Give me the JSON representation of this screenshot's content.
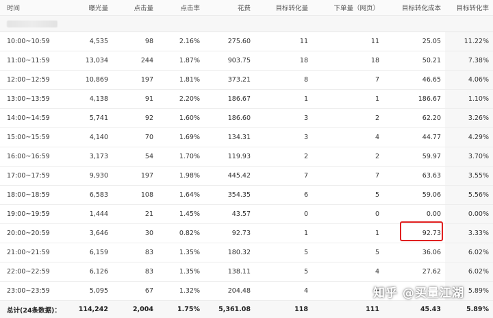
{
  "columns": [
    "时间",
    "曝光量",
    "点击量",
    "点击率",
    "花费",
    "目标转化量",
    "下单量（网页）",
    "目标转化成本",
    "目标转化率"
  ],
  "rows": [
    [
      "10:00~10:59",
      "4,535",
      "98",
      "2.16%",
      "275.60",
      "11",
      "11",
      "25.05",
      "11.22%"
    ],
    [
      "11:00~11:59",
      "13,034",
      "244",
      "1.87%",
      "903.75",
      "18",
      "18",
      "50.21",
      "7.38%"
    ],
    [
      "12:00~12:59",
      "10,869",
      "197",
      "1.81%",
      "373.21",
      "8",
      "7",
      "46.65",
      "4.06%"
    ],
    [
      "13:00~13:59",
      "4,138",
      "91",
      "2.20%",
      "186.67",
      "1",
      "1",
      "186.67",
      "1.10%"
    ],
    [
      "14:00~14:59",
      "5,741",
      "92",
      "1.60%",
      "186.60",
      "3",
      "2",
      "62.20",
      "3.26%"
    ],
    [
      "15:00~15:59",
      "4,140",
      "70",
      "1.69%",
      "134.31",
      "3",
      "4",
      "44.77",
      "4.29%"
    ],
    [
      "16:00~16:59",
      "3,173",
      "54",
      "1.70%",
      "119.93",
      "2",
      "2",
      "59.97",
      "3.70%"
    ],
    [
      "17:00~17:59",
      "9,930",
      "197",
      "1.98%",
      "445.42",
      "7",
      "7",
      "63.63",
      "3.55%"
    ],
    [
      "18:00~18:59",
      "6,583",
      "108",
      "1.64%",
      "354.35",
      "6",
      "5",
      "59.06",
      "5.56%"
    ],
    [
      "19:00~19:59",
      "1,444",
      "21",
      "1.45%",
      "43.57",
      "0",
      "0",
      "0.00",
      "0.00%"
    ],
    [
      "20:00~20:59",
      "3,646",
      "30",
      "0.82%",
      "92.73",
      "1",
      "1",
      "92.73",
      "3.33%"
    ],
    [
      "21:00~21:59",
      "6,159",
      "83",
      "1.35%",
      "180.32",
      "5",
      "5",
      "36.06",
      "6.02%"
    ],
    [
      "22:00~22:59",
      "6,126",
      "83",
      "1.35%",
      "138.11",
      "5",
      "4",
      "27.62",
      "6.02%"
    ],
    [
      "23:00~23:59",
      "5,095",
      "67",
      "1.32%",
      "204.48",
      "4",
      "4",
      "",
      "5.89%"
    ]
  ],
  "total": [
    "总计(24条数据)：",
    "114,242",
    "2,004",
    "1.75%",
    "5,361.08",
    "118",
    "111",
    "45.43",
    "5.89%"
  ],
  "watermark": "知乎 @买量江湖",
  "colors": {
    "highlight": "#e02020"
  }
}
